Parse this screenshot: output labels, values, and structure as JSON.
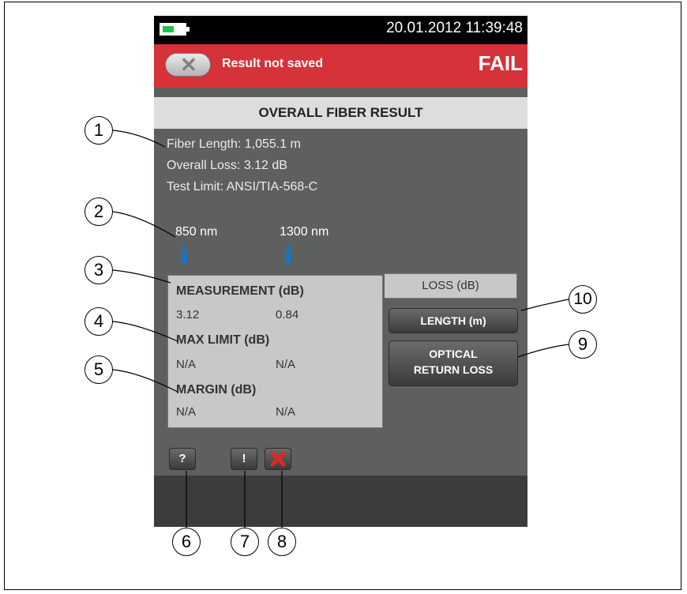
{
  "status_bar": {
    "datetime": "20.01.2012 11:39:48",
    "battery_icon": "battery-icon"
  },
  "header": {
    "save_status": "Result not saved",
    "verdict": "FAIL",
    "back_icon": "close-x-icon",
    "color": "#d5323a"
  },
  "title": "OVERALL FIBER RESULT",
  "summary": {
    "fiber_length": "Fiber Length: 1,055.1 m",
    "overall_loss": "Overall Loss: 3.12 dB",
    "test_limit": "Test Limit: ANSI/TIA-568-C"
  },
  "wavelengths": [
    "850 nm",
    "1300 nm"
  ],
  "panel": {
    "measurement_label": "MEASUREMENT (dB)",
    "measurement_values": [
      "3.12",
      "0.84"
    ],
    "max_limit_label": "MAX LIMIT (dB)",
    "max_limit_values": [
      "N/A",
      "N/A"
    ],
    "margin_label": "MARGIN (dB)",
    "margin_values": [
      "N/A",
      "N/A"
    ]
  },
  "tabs": {
    "loss": "LOSS (dB)",
    "length": "LENGTH (m)",
    "orl_line1": "OPTICAL",
    "orl_line2": "RETURN LOSS"
  },
  "bottom_buttons": {
    "help": "?",
    "warning": "!",
    "delete_icon": "red-x-icon"
  },
  "callouts": [
    "1",
    "2",
    "3",
    "4",
    "5",
    "6",
    "7",
    "8",
    "9",
    "10"
  ]
}
